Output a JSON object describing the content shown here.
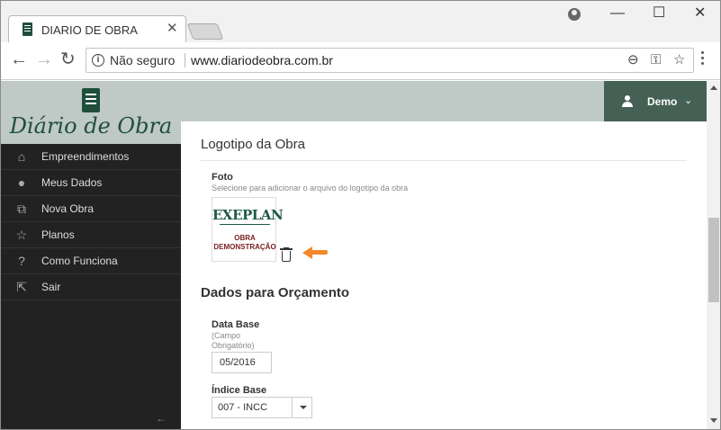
{
  "browser": {
    "tab_title": "DIARIO DE OBRA",
    "close_glyph": "✕",
    "security_text": "Não seguro",
    "url": "www.diariodeobra.com.br",
    "window_controls": [
      "—",
      "☐",
      "✕"
    ],
    "nav_glyphs": {
      "back": "←",
      "forward": "→",
      "reload": "↻"
    },
    "info_glyph": "i",
    "omnibox_icons": {
      "zoom": "⊖",
      "key": "⚿",
      "star": "☆"
    }
  },
  "sidebar": {
    "logo_text": "Diário de Obra",
    "items": [
      {
        "label": "Empreendimentos",
        "icon": "⌂"
      },
      {
        "label": "Meus Dados",
        "icon": "●"
      },
      {
        "label": "Nova Obra",
        "icon": "⧉"
      },
      {
        "label": "Planos",
        "icon": "☆"
      },
      {
        "label": "Como Funciona",
        "icon": "?"
      },
      {
        "label": "Sair",
        "icon": "⇱"
      }
    ],
    "collapse_glyph": "←"
  },
  "header": {
    "user_name": "Demo",
    "caret_glyph": "⌄"
  },
  "main": {
    "logo_section": {
      "title": "Logotipo da Obra",
      "field_label": "Foto",
      "help": "Selecione para adicionar o arquivo do logotipo da obra",
      "thumbnail": {
        "brand": "EXEPLAN",
        "caption_line1": "OBRA",
        "caption_line2": "DEMONSTRAÇÃO"
      }
    },
    "budget_section": {
      "title": "Dados para Orçamento",
      "data_base": {
        "label": "Data Base",
        "help_line1": "(Campo",
        "help_line2": "Obrigatório)",
        "value": "05/2016"
      },
      "indice_base": {
        "label": "Índice Base",
        "value": "007 - INCC"
      }
    }
  },
  "colors": {
    "brand_green": "#1f4f3c",
    "header_bg": "#bfc9c5",
    "sidebar_bg": "#222222",
    "user_menu_bg": "#456156",
    "arrow_orange": "#f5882a"
  }
}
